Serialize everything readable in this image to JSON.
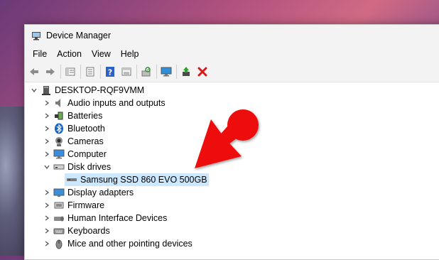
{
  "window": {
    "title": "Device Manager"
  },
  "menu": [
    "File",
    "Action",
    "View",
    "Help"
  ],
  "toolbar": {
    "buttons": [
      "back-icon",
      "forward-icon",
      "properties-view-icon",
      "list-view-icon",
      "help-icon",
      "details-view-icon",
      "scan-hardware-icon",
      "monitor-icon",
      "update-driver-icon",
      "uninstall-icon"
    ]
  },
  "tree": {
    "root": "DESKTOP-RQF9VMM",
    "items": [
      {
        "label": "Audio inputs and outputs",
        "icon": "speaker-icon",
        "expanded": false
      },
      {
        "label": "Batteries",
        "icon": "battery-icon",
        "expanded": false
      },
      {
        "label": "Bluetooth",
        "icon": "bluetooth-icon",
        "expanded": false
      },
      {
        "label": "Cameras",
        "icon": "camera-icon",
        "expanded": false
      },
      {
        "label": "Computer",
        "icon": "computer-icon",
        "expanded": false
      },
      {
        "label": "Disk drives",
        "icon": "disk-drive-icon",
        "expanded": true
      },
      {
        "label": "Samsung SSD 860 EVO 500GB",
        "icon": "disk-drive-icon",
        "child": true,
        "selected": true
      },
      {
        "label": "Display adapters",
        "icon": "display-adapter-icon",
        "expanded": false
      },
      {
        "label": "Firmware",
        "icon": "firmware-icon",
        "expanded": false
      },
      {
        "label": "Human Interface Devices",
        "icon": "hid-icon",
        "expanded": false
      },
      {
        "label": "Keyboards",
        "icon": "keyboard-icon",
        "expanded": false
      },
      {
        "label": "Mice and other pointing devices",
        "icon": "mouse-icon",
        "expanded": false
      }
    ]
  },
  "colors": {
    "selection": "#cce8ff",
    "annotation": "#ee1111"
  }
}
